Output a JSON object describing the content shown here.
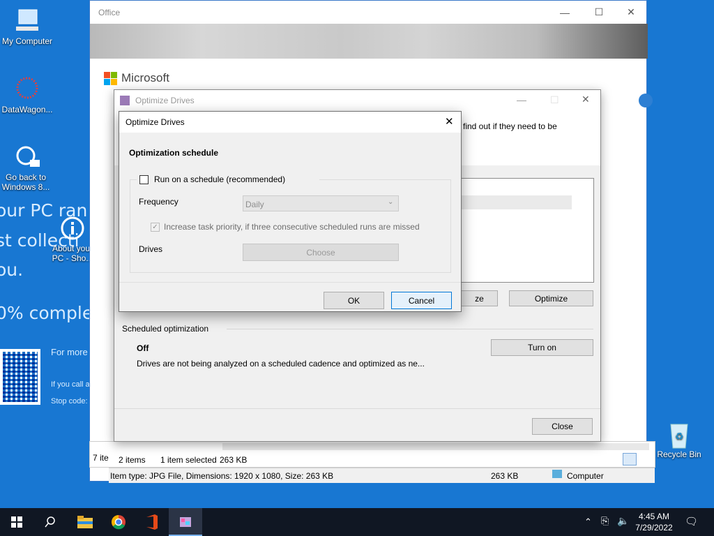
{
  "desktop": {
    "icons": [
      {
        "label": "My Computer"
      },
      {
        "label": "DataWagon..."
      },
      {
        "label": "Go back to Windows 8..."
      },
      {
        "label": "About your PC - Sho..."
      },
      {
        "label": "Recycle Bin"
      }
    ],
    "bsod": {
      "line1": "our PC ran",
      "line2": "st collecti",
      "line3": "ou.",
      "line4": "0% complete",
      "more": "For more",
      "call": "If you call a",
      "stop": "Stop code:"
    }
  },
  "office_window": {
    "title": "Office",
    "brand": "Microsoft",
    "partial_text_line1": "find out if they need to be"
  },
  "optimize_window": {
    "title": "Optimize Drives",
    "analyze_label": "ze",
    "optimize_label": "Optimize",
    "scheduled_header": "Scheduled optimization",
    "schedule_state": "Off",
    "schedule_desc": "Drives are not being analyzed on a scheduled cadence and optimized as ne...",
    "turn_on_label": "Turn on",
    "close_label": "Close"
  },
  "dialog": {
    "title": "Optimize Drives",
    "heading": "Optimization schedule",
    "run_schedule_label": "Run on a schedule (recommended)",
    "frequency_label": "Frequency",
    "frequency_value": "Daily",
    "priority_label": "Increase task priority, if three consecutive scheduled runs are missed",
    "drives_label": "Drives",
    "choose_label": "Choose",
    "ok_label": "OK",
    "cancel_label": "Cancel"
  },
  "explorer_status": {
    "items_left": "7 ite",
    "items": "2 items",
    "selected": "1 item selected",
    "size": "263 KB",
    "item_type": "Item type: JPG File, Dimensions: 1920 x 1080, Size: 263 KB",
    "size2": "263 KB",
    "location": "Computer"
  },
  "taskbar": {
    "time": "4:45 AM",
    "date": "7/29/2022"
  }
}
